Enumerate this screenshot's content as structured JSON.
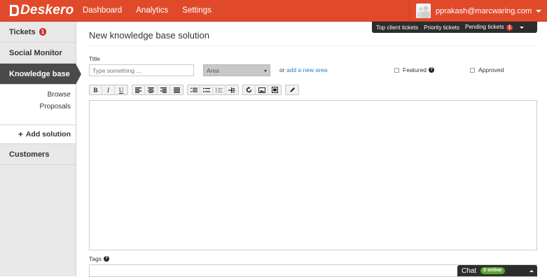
{
  "brand": {
    "logo_text": "Deskero",
    "colors": {
      "topbar": "#e04a2a",
      "sidebar_active": "#4a4a4a",
      "badge": "#c9302c",
      "link": "#2a7fc1",
      "chat_badge": "#5aa532"
    }
  },
  "nav": [
    {
      "label": "Dashboard"
    },
    {
      "label": "Analytics"
    },
    {
      "label": "Settings"
    }
  ],
  "user": {
    "email": "pprakash@marcwaring.com",
    "avatar_icon": "user-avatar-icon"
  },
  "quickbar": {
    "top_client": "Top client tickets",
    "priority": "Priority tickets",
    "pending": "Pending tickets",
    "pending_count": "1"
  },
  "sidebar": {
    "tickets": {
      "label": "Tickets",
      "count": "1"
    },
    "social": {
      "label": "Social Monitor"
    },
    "kb": {
      "label": "Knowledge base",
      "browse": "Browse",
      "proposals": "Proposals",
      "add": "Add solution"
    },
    "customers": {
      "label": "Customers"
    }
  },
  "form": {
    "page_title": "New knowledge base solution",
    "title_label": "Title",
    "title_placeholder": "Type something ...",
    "area_value": "Area",
    "or_text": "or",
    "add_area_link": "add a new area",
    "featured_label": "Featured",
    "featured_help": "?",
    "approved_label": "Approved",
    "tags_label": "Tags",
    "tags_help": "?"
  },
  "toolbar": {
    "bold": "B",
    "italic": "I",
    "underline": "U",
    "icons": [
      "align-left-icon",
      "align-center-icon",
      "align-right-icon",
      "align-justify-icon",
      "ordered-list-icon",
      "unordered-list-icon",
      "outdent-icon",
      "indent-icon",
      "undo-icon",
      "image-icon",
      "video-icon",
      "pencil-icon"
    ]
  },
  "chat": {
    "label": "Chat",
    "status": "0 online"
  }
}
